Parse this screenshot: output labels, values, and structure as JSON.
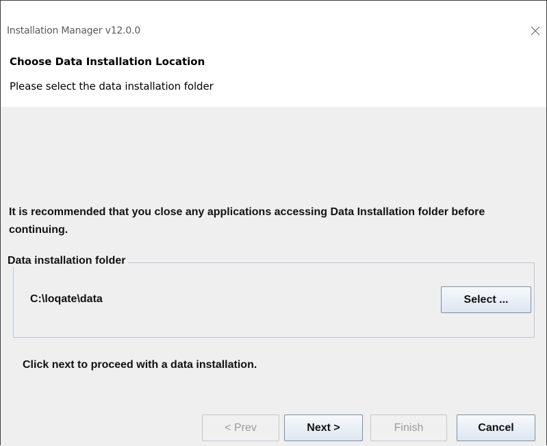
{
  "window": {
    "title": "Installation Manager v12.0.0",
    "close_icon": "close-icon"
  },
  "header": {
    "title": "Choose Data Installation Location",
    "subtitle": "Please select the data installation folder"
  },
  "main": {
    "warning": "It is recommended that you close any applications accessing Data Installation folder before continuing.",
    "group": {
      "legend": "Data installation folder",
      "path": "C:\\loqate\\data",
      "select_label": "Select ..."
    },
    "hint": "Click next to proceed with a data installation."
  },
  "footer": {
    "prev_label": "< Prev",
    "next_label": "Next >",
    "finish_label": "Finish",
    "cancel_label": "Cancel",
    "prev_enabled": false,
    "finish_enabled": false
  },
  "colors": {
    "title_text": "#5a5a5a",
    "panel_bg": "#efefef",
    "groupbox_border": "#b5c7dc",
    "button_border": "#7a8ea6",
    "disabled_text": "#9a9a9a"
  }
}
